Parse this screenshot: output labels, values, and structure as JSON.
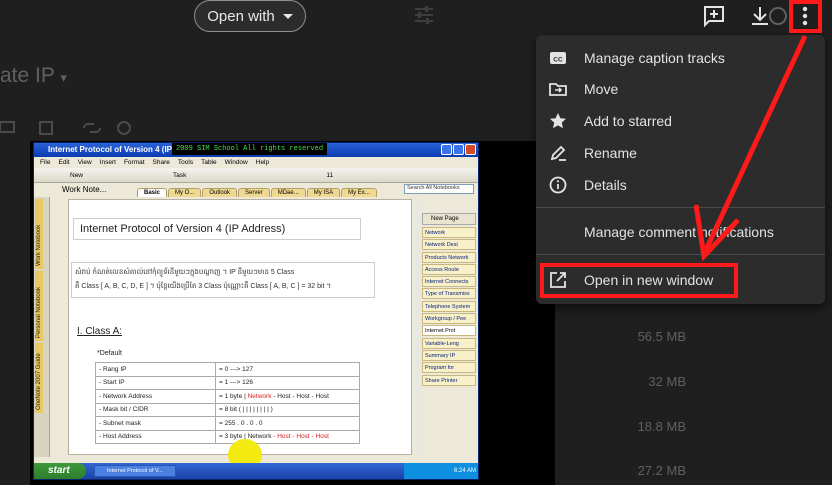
{
  "topbar": {
    "open_with_label": "Open with"
  },
  "background": {
    "title_fragment": "ate IP",
    "file_sizes": [
      "56.5 MB",
      "32 MB",
      "18.8 MB",
      "27.2 MB"
    ]
  },
  "video": {
    "window_title": "Internet Protocol of Version 4 (IP Ad",
    "overlay_text": "2009 SIM School  All rights reserved",
    "menu_items": [
      "File",
      "Edit",
      "View",
      "Insert",
      "Format",
      "Share",
      "Tools",
      "Table",
      "Window",
      "Help"
    ],
    "toolbar_items": [
      "New",
      "Task",
      "11"
    ],
    "notebook_label": "Work Note...",
    "tabs": [
      "Basic",
      "My O...",
      "Outlook",
      "Server",
      "MDae...",
      "My ISA",
      "My Ex..."
    ],
    "search_placeholder": "Search All Notebooks",
    "side_notebooks": [
      "Work Notebook",
      "Personal Notebook",
      "OneNote 2007 Guide"
    ],
    "page_title": "Internet Protocol of Version 4 (IP Address)",
    "khmer_text_line1": "សំរាប់ កំណត់លេខសំគាល់នៅកុំព្យូទ័រនីមួយៗក្នុងបណ្ដាញ ។ IP នីមួយៗមាន 5 Class",
    "khmer_text_line2": "គឺ Class [ A, B, C, D, E ] ។ ប៉ុន្តែយើងប្រើតែ 3 Class ប៉ុណ្ណោះគឺ Class [ A, B, C ] = 32 bit ។",
    "class_heading": "I. Class  A:",
    "default_label": "*Default",
    "table": [
      {
        "name": "- Rang IP",
        "value": "= 0 ---> 127",
        "value_suffix": ""
      },
      {
        "name": "- Start IP",
        "value": "= 1 ---> 126",
        "value_suffix": ""
      },
      {
        "name": "- Network Address",
        "value": "= 1 byte | ",
        "red": "Network",
        "value_suffix": " - Host - Host - Host"
      },
      {
        "name": "- Mask bit / CIDR",
        "value": "= 8 bit ( | | | | | | | | )",
        "value_suffix": ""
      },
      {
        "name": "- Subnet mask",
        "value": "= 255 . 0 . 0 . 0",
        "value_suffix": ""
      },
      {
        "name": "- Host Address",
        "value": "= 3 byte | Network",
        "red": " - Host - Host - Host",
        "value_suffix": ""
      }
    ],
    "new_page_label": "New Page",
    "pages": [
      "Network",
      "Network Desi",
      "Products Network",
      "Access Route",
      "Internet Connects",
      "Type of Transmiss",
      "Telephone System",
      "Workgroup / Pee",
      "Internet Prot",
      "Variable-Leng",
      "Summary IP",
      "Program for",
      "Share Printer"
    ],
    "selected_page_index": 8,
    "taskbar_start": "start",
    "taskbar_task": "Internet Protocol of V...",
    "taskbar_time": "6:24 AM"
  },
  "context_menu": {
    "items": [
      {
        "label": "Manage caption tracks",
        "icon": "closed-caption-icon"
      },
      {
        "label": "Move",
        "icon": "move-to-folder-icon"
      },
      {
        "label": "Add to starred",
        "icon": "star-icon"
      },
      {
        "label": "Rename",
        "icon": "pencil-icon"
      },
      {
        "label": "Details",
        "icon": "info-icon"
      },
      {
        "label": "Manage comment notifications",
        "icon": ""
      },
      {
        "label": "Open in new window",
        "icon": "open-in-new-icon"
      }
    ]
  },
  "annotation_color": "#ff1a1a"
}
